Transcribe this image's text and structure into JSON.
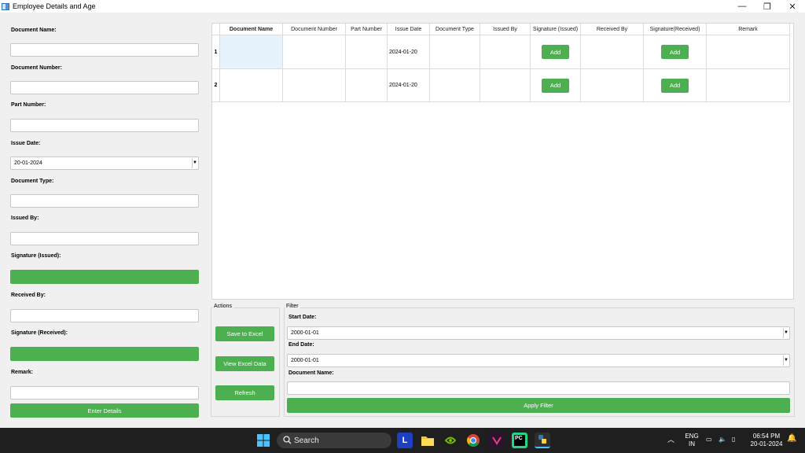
{
  "window": {
    "title": "Employee Details and Age",
    "minimize": "—",
    "restore": "❐",
    "close": "✕"
  },
  "form": {
    "document_name_label": "Document Name:",
    "document_number_label": "Document Number:",
    "part_number_label": "Part Number:",
    "issue_date_label": "Issue Date:",
    "issue_date_value": "20-01-2024",
    "document_type_label": "Document Type:",
    "issued_by_label": "Issued By:",
    "signature_issued_label": "Signature (Issued):",
    "received_by_label": "Received By:",
    "signature_received_label": "Signature (Received):",
    "remark_label": "Remark:",
    "enter_details_button": "Enter Details"
  },
  "table": {
    "columns": [
      "Document Name",
      "Document Number",
      "Part Number",
      "Issue Date",
      "Document Type",
      "Issued By",
      "Signature (Issued)",
      "Received By",
      "Signature(Received)",
      "Remark"
    ],
    "rows": [
      {
        "index": "1",
        "document_name": "",
        "document_number": "",
        "part_number": "",
        "issue_date": "2024-01-20",
        "document_type": "",
        "issued_by": "",
        "sig_issued_button": "Add",
        "received_by": "",
        "sig_received_button": "Add",
        "remark": ""
      },
      {
        "index": "2",
        "document_name": "",
        "document_number": "",
        "part_number": "",
        "issue_date": "2024-01-20",
        "document_type": "",
        "issued_by": "",
        "sig_issued_button": "Add",
        "received_by": "",
        "sig_received_button": "Add",
        "remark": ""
      }
    ]
  },
  "actions": {
    "title": "Actions",
    "save_to_excel": "Save to Excel",
    "view_excel_data": "View Excel Data",
    "refresh": "Refresh"
  },
  "filter": {
    "title": "Filter",
    "start_date_label": "Start Date:",
    "start_date_value": "2000-01-01",
    "end_date_label": "End Date:",
    "end_date_value": "2000-01-01",
    "document_name_label": "Document Name:",
    "apply_filter": "Apply Filter"
  },
  "taskbar": {
    "search_label": "Search",
    "lang_top": "ENG",
    "lang_bottom": "IN",
    "time": "06:54 PM",
    "date": "20-01-2024"
  },
  "colors": {
    "accent_green": "#4caf50",
    "taskbar_bg": "#1f1f1f"
  }
}
